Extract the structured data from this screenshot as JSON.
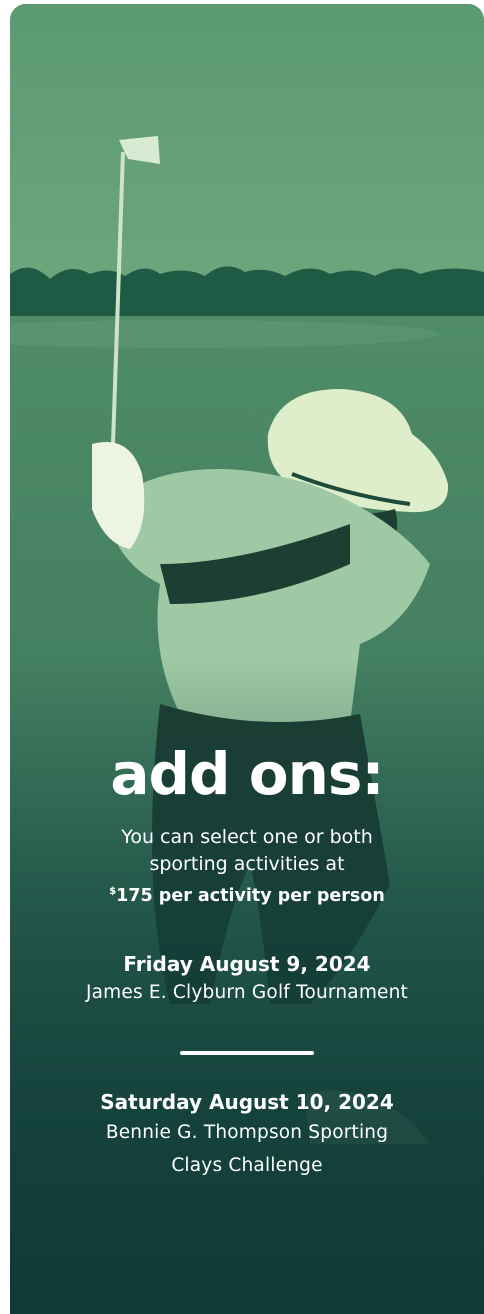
{
  "card": {
    "heading": "add ons:",
    "intro_line1": "You can select one or both",
    "intro_line2": "sporting activities at",
    "price_currency": "$",
    "price_text": "175 per activity per person",
    "events": [
      {
        "date": "Friday August 9, 2024",
        "name_line1": "James E. Clyburn Golf Tournament"
      },
      {
        "date": "Saturday August 10, 2024",
        "name_line1": "Bennie G. Thompson Sporting",
        "name_line2": "Clays Challenge"
      }
    ]
  },
  "colors": {
    "overlay_top": "#5f9a72",
    "overlay_bottom": "#184a44",
    "text": "#ffffff"
  }
}
